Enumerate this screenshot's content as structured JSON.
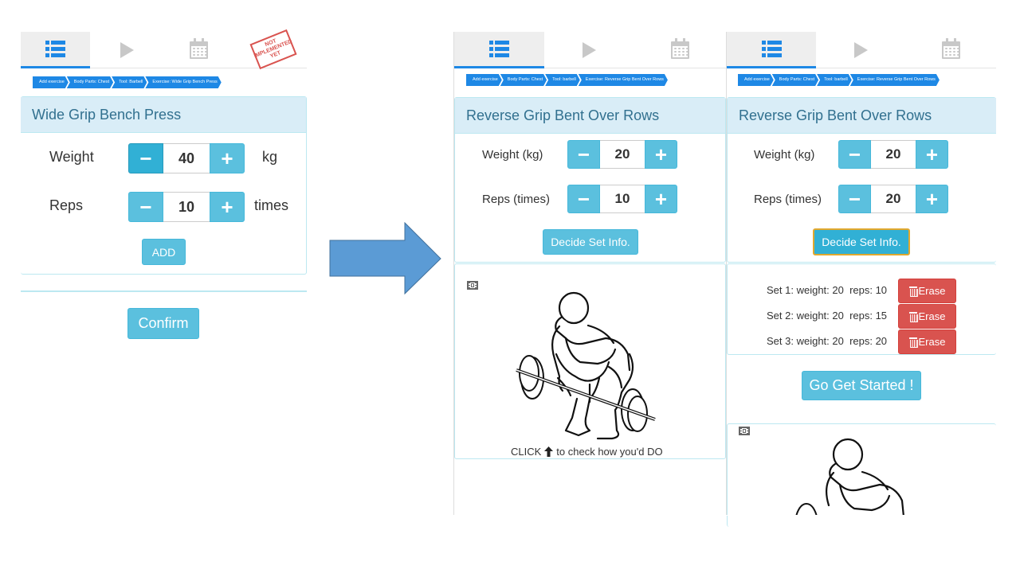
{
  "left_screen": {
    "not_implemented_stamp": "NOT\nIMPLEMENTED\nYET",
    "breadcrumb": [
      "Add exercise",
      "Body Parts: Chest",
      "Tool: Barbell",
      "Exercise: Wide Grip Bench Press"
    ],
    "exercise_title": "Wide Grip Bench Press",
    "weight": {
      "label": "Weight",
      "value": "40",
      "unit": "kg"
    },
    "reps": {
      "label": "Reps",
      "value": "10",
      "unit": "times"
    },
    "add_label": "ADD",
    "confirm_label": "Confirm"
  },
  "middle_screen": {
    "breadcrumb": [
      "Add exercise",
      "Body Parts: Chest",
      "Tool: barbell",
      "Exercise: Reverse Grip Bent Over Rows"
    ],
    "exercise_title": "Reverse Grip Bent Over Rows",
    "weight": {
      "label": "Weight (kg)",
      "value": "20"
    },
    "reps": {
      "label": "Reps (times)",
      "value": "10"
    },
    "decide_label": "Decide Set Info.",
    "click_hint_prefix": "CLICK",
    "click_hint_suffix": "to check how you'd DO"
  },
  "right_screen": {
    "breadcrumb": [
      "Add exercise",
      "Body Parts: Chest",
      "Tool: barbell",
      "Exercise: Reverse Grip Bent Over Rows"
    ],
    "exercise_title": "Reverse Grip Bent Over Rows",
    "weight": {
      "label": "Weight (kg)",
      "value": "20"
    },
    "reps": {
      "label": "Reps (times)",
      "value": "20"
    },
    "decide_label": "Decide Set Info.",
    "sets": [
      {
        "text": "Set 1: weight: 20  reps: 10"
      },
      {
        "text": "Set 2: weight: 20  reps: 15"
      },
      {
        "text": "Set 3: weight: 20  reps: 20"
      }
    ],
    "erase_label": "Erase",
    "go_label": "Go Get Started !"
  },
  "colors": {
    "primary_blue": "#1e88e5",
    "info": "#5bc0de",
    "info_dark": "#31b0d5",
    "danger": "#d9534f",
    "panel_head_bg": "#d9edf7",
    "panel_head_text": "#31708f",
    "arrow": "#5b9bd5"
  }
}
